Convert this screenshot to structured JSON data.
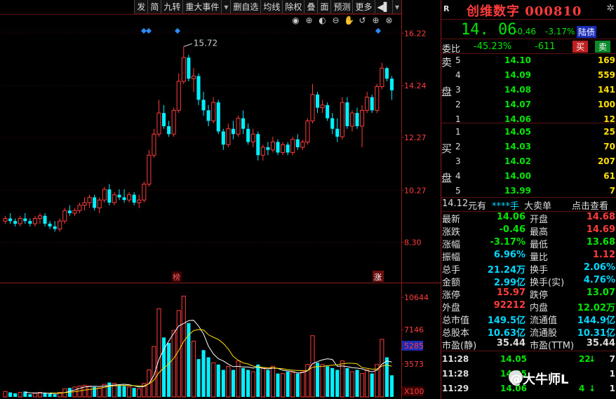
{
  "toolbar": {
    "items": [
      "发",
      "简",
      "九转",
      "重大事件",
      "▾",
      "删自选",
      "均线",
      "除权",
      "叠",
      "面",
      "预测",
      "更多",
      "◀▌",
      "▾"
    ]
  },
  "tools": [
    "eye-icon",
    "zoom-in-icon",
    "play-icon",
    "minus-zoom-icon",
    "hand-icon",
    "undo-icon",
    "add-icon",
    "close-icon"
  ],
  "chart_data": {
    "type": "candlestick",
    "price_axis": {
      "ticks": [
        "16.22",
        "14.24",
        "12.27",
        "10.27",
        "8.30"
      ],
      "range": [
        6.9,
        16.9
      ]
    },
    "volume_axis": {
      "ticks": [
        "10644",
        "7146",
        "5285",
        "3573",
        "X100"
      ],
      "range": [
        0,
        12000
      ]
    },
    "max_label": "15.72",
    "markers": [
      "榜",
      "涨"
    ],
    "candles": [
      [
        9.1,
        9.3,
        9.0,
        9.2
      ],
      [
        9.2,
        9.4,
        9.0,
        9.1
      ],
      [
        9.1,
        9.2,
        8.9,
        9.0
      ],
      [
        9.0,
        9.3,
        8.9,
        9.2
      ],
      [
        9.2,
        9.4,
        9.0,
        9.1
      ],
      [
        9.1,
        9.2,
        8.9,
        9.0
      ],
      [
        9.0,
        9.3,
        8.9,
        9.2
      ],
      [
        9.2,
        9.4,
        9.0,
        9.3
      ],
      [
        9.3,
        9.4,
        8.9,
        9.0
      ],
      [
        9.0,
        9.1,
        8.8,
        8.9
      ],
      [
        8.9,
        9.1,
        8.7,
        8.8
      ],
      [
        8.8,
        9.2,
        8.7,
        9.1
      ],
      [
        9.1,
        9.6,
        9.0,
        9.5
      ],
      [
        9.5,
        9.7,
        9.3,
        9.4
      ],
      [
        9.4,
        9.6,
        9.3,
        9.5
      ],
      [
        9.5,
        9.8,
        9.4,
        9.7
      ],
      [
        9.7,
        10.0,
        9.5,
        9.8
      ],
      [
        9.8,
        10.1,
        9.6,
        10.0
      ],
      [
        10.0,
        10.1,
        9.5,
        9.6
      ],
      [
        9.6,
        10.0,
        9.4,
        9.9
      ],
      [
        9.9,
        10.4,
        9.8,
        10.3
      ],
      [
        10.3,
        10.5,
        9.7,
        9.8
      ],
      [
        9.8,
        10.2,
        9.7,
        10.1
      ],
      [
        10.1,
        10.3,
        9.9,
        10.0
      ],
      [
        10.0,
        10.3,
        9.8,
        9.9
      ],
      [
        9.9,
        10.2,
        9.8,
        10.1
      ],
      [
        10.1,
        10.2,
        9.7,
        9.8
      ],
      [
        9.8,
        10.1,
        9.6,
        9.9
      ],
      [
        9.9,
        10.6,
        9.8,
        10.5
      ],
      [
        10.5,
        11.8,
        10.4,
        11.6
      ],
      [
        11.6,
        12.6,
        11.5,
        12.4
      ],
      [
        12.4,
        13.7,
        12.3,
        13.2
      ],
      [
        13.2,
        13.5,
        12.6,
        12.7
      ],
      [
        12.7,
        12.9,
        12.3,
        12.4
      ],
      [
        12.4,
        13.4,
        12.3,
        13.3
      ],
      [
        13.3,
        14.7,
        13.2,
        14.4
      ],
      [
        14.4,
        15.72,
        14.3,
        15.3
      ],
      [
        15.3,
        15.4,
        14.4,
        14.5
      ],
      [
        14.5,
        14.9,
        14.0,
        14.6
      ],
      [
        14.6,
        14.7,
        13.5,
        13.7
      ],
      [
        13.7,
        14.0,
        13.1,
        13.3
      ],
      [
        13.3,
        13.5,
        12.7,
        12.9
      ],
      [
        12.9,
        13.8,
        12.8,
        13.6
      ],
      [
        13.6,
        13.7,
        12.4,
        12.5
      ],
      [
        12.5,
        12.6,
        11.8,
        12.0
      ],
      [
        12.0,
        12.8,
        11.9,
        12.6
      ],
      [
        12.6,
        12.9,
        12.2,
        12.4
      ],
      [
        12.4,
        13.1,
        12.3,
        13.0
      ],
      [
        13.0,
        13.3,
        12.4,
        12.6
      ],
      [
        12.6,
        12.8,
        12.0,
        12.1
      ],
      [
        12.1,
        12.6,
        11.9,
        12.4
      ],
      [
        12.4,
        12.5,
        11.4,
        11.6
      ],
      [
        11.6,
        12.0,
        11.4,
        11.9
      ],
      [
        11.9,
        12.1,
        11.6,
        11.8
      ],
      [
        11.8,
        12.3,
        11.7,
        12.1
      ],
      [
        12.1,
        12.2,
        11.6,
        11.7
      ],
      [
        11.7,
        12.1,
        11.6,
        12.0
      ],
      [
        12.0,
        12.1,
        11.6,
        11.7
      ],
      [
        11.7,
        12.3,
        11.6,
        12.2
      ],
      [
        12.2,
        12.4,
        11.8,
        11.9
      ],
      [
        11.9,
        12.2,
        11.8,
        12.1
      ],
      [
        12.1,
        13.0,
        12.0,
        12.9
      ],
      [
        12.9,
        14.3,
        12.8,
        13.9
      ],
      [
        13.9,
        14.0,
        13.2,
        13.4
      ],
      [
        13.4,
        13.7,
        13.2,
        13.5
      ],
      [
        13.5,
        13.6,
        12.9,
        13.0
      ],
      [
        13.0,
        13.2,
        12.4,
        12.6
      ],
      [
        12.6,
        13.0,
        12.1,
        12.3
      ],
      [
        12.3,
        13.8,
        12.2,
        13.6
      ],
      [
        13.6,
        13.8,
        12.6,
        12.7
      ],
      [
        12.7,
        13.3,
        12.5,
        13.2
      ],
      [
        13.2,
        13.4,
        12.6,
        12.7
      ],
      [
        12.7,
        13.5,
        11.9,
        13.3
      ],
      [
        13.3,
        14.0,
        13.2,
        13.8
      ],
      [
        13.8,
        13.9,
        13.2,
        13.3
      ],
      [
        13.3,
        14.3,
        13.2,
        14.2
      ],
      [
        14.2,
        15.1,
        14.1,
        14.9
      ],
      [
        14.9,
        14.95,
        14.4,
        14.5
      ],
      [
        14.5,
        14.6,
        13.7,
        14.06
      ]
    ],
    "volumes": [
      600,
      500,
      400,
      500,
      600,
      300,
      400,
      500,
      400,
      350,
      300,
      500,
      900,
      1000,
      1100,
      1200,
      1300,
      1200,
      1100,
      1000,
      1400,
      1600,
      1500,
      1300,
      1200,
      1100,
      1000,
      900,
      1500,
      3000,
      5600,
      9800,
      6600,
      6000,
      7400,
      9600,
      11200,
      8200,
      6200,
      4200,
      5200,
      4400,
      3800,
      3600,
      3000,
      3400,
      3000,
      4000,
      3200,
      3000,
      2800,
      3600,
      3200,
      3000,
      3400,
      2600,
      2600,
      2800,
      2700,
      2600,
      2800,
      3600,
      6800,
      3800,
      3600,
      3400,
      3200,
      3000,
      4000,
      3200,
      2800,
      3000,
      2600,
      3000,
      2600,
      3600,
      6400,
      4400,
      2400
    ]
  },
  "header": {
    "r_label": "R",
    "title": "创维数字 000810",
    "settings_icon": "gear-icon"
  },
  "quote": {
    "last": "14. 06",
    "change": "-0.46",
    "pct": "-3.17%",
    "badge": "陆债"
  },
  "weibi": {
    "label": "委比",
    "value": "-45.23%",
    "diff": "-611",
    "buy": "买",
    "sell": "卖"
  },
  "asks": [
    {
      "side": "卖",
      "lvl": "5",
      "price": "14.10",
      "vol": "169"
    },
    {
      "side": "",
      "lvl": "4",
      "price": "14.09",
      "vol": "559"
    },
    {
      "side": "盘",
      "lvl": "3",
      "price": "14.08",
      "vol": "141"
    },
    {
      "side": "",
      "lvl": "2",
      "price": "14.07",
      "vol": "100"
    },
    {
      "side": "",
      "lvl": "1",
      "price": "14.06",
      "vol": "12"
    }
  ],
  "bids": [
    {
      "side": "",
      "lvl": "1",
      "price": "14.05",
      "vol": "25"
    },
    {
      "side": "买",
      "lvl": "2",
      "price": "14.03",
      "vol": "70"
    },
    {
      "side": "",
      "lvl": "3",
      "price": "14.02",
      "vol": "207"
    },
    {
      "side": "盘",
      "lvl": "4",
      "price": "14.00",
      "vol": "61"
    },
    {
      "side": "",
      "lvl": "5",
      "price": "13.99",
      "vol": "7"
    }
  ],
  "bigorder": {
    "price": "14.12",
    "yuanyou": "元有",
    "stars": "****手",
    "label": "大卖单",
    "link": "点击查看"
  },
  "stats": [
    {
      "l1": "最新",
      "v1": "14.06",
      "c1": "green",
      "l2": "开盘",
      "v2": "14.68",
      "c2": "red"
    },
    {
      "l1": "涨跌",
      "v1": "-0.46",
      "c1": "green",
      "l2": "最高",
      "v2": "14.69",
      "c2": "red"
    },
    {
      "l1": "涨幅",
      "v1": "-3.17%",
      "c1": "green",
      "l2": "最低",
      "v2": "13.68",
      "c2": "green"
    },
    {
      "l1": "振幅",
      "v1": "6.96%",
      "c1": "cyan",
      "l2": "量比",
      "v2": "1.12",
      "c2": "red"
    },
    {
      "l1": "总手",
      "v1": "21.24万",
      "c1": "cyan",
      "l2": "换手",
      "v2": "2.06%",
      "c2": "cyan"
    },
    {
      "l1": "金额",
      "v1": "2.99亿",
      "c1": "cyan",
      "l2": "换手(实)",
      "v2": "4.76%",
      "c2": "cyan"
    },
    {
      "l1": "涨停",
      "v1": "15.97",
      "c1": "red",
      "l2": "跌停",
      "v2": "13.07",
      "c2": "green"
    },
    {
      "l1": "外盘",
      "v1": "92212",
      "c1": "red",
      "l2": "内盘",
      "v2": "12.02万",
      "c2": "green"
    },
    {
      "l1": "总市值",
      "v1": "149.5亿",
      "c1": "cyan",
      "l2": "流通值",
      "v2": "144.9亿",
      "c2": "cyan"
    },
    {
      "l1": "总股本",
      "v1": "10.63亿",
      "c1": "cyan",
      "l2": "流通股",
      "v2": "10.31亿",
      "c2": "cyan"
    },
    {
      "l1": "市盈(静)",
      "v1": "35.44",
      "c1": "white",
      "l2": "市盈(TTM)",
      "v2": "35.44",
      "c2": "white"
    }
  ],
  "ticks": [
    {
      "time": "11:28",
      "price": "14.05",
      "vol": "22",
      "arrow": "↓",
      "n": "7"
    },
    {
      "time": "11:28",
      "price": "14.05",
      "vol": "",
      "arrow": "",
      "n": "1"
    },
    {
      "time": "11:29",
      "price": "14.06",
      "vol": "4",
      "arrow": "↓",
      "n": "1"
    }
  ],
  "watermark": "@大牛师L"
}
